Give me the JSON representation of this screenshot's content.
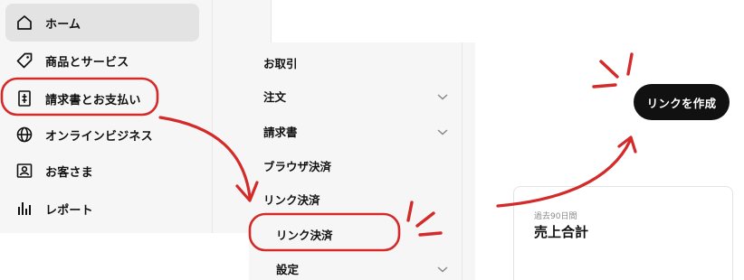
{
  "sidebar": {
    "items": [
      {
        "label": "ホーム",
        "icon": "home-icon",
        "active": true
      },
      {
        "label": "商品とサービス",
        "icon": "tag-icon"
      },
      {
        "label": "請求書とお支払い",
        "icon": "invoice-icon",
        "highlighted": true
      },
      {
        "label": "オンラインビジネス",
        "icon": "globe-icon"
      },
      {
        "label": "お客さま",
        "icon": "customer-icon"
      },
      {
        "label": "レポート",
        "icon": "bar-chart-icon"
      }
    ]
  },
  "submenu": {
    "items": [
      {
        "label": "お取引"
      },
      {
        "label": "注文",
        "icon": "chevron-down-icon"
      },
      {
        "label": "請求書",
        "icon": "chevron-down-icon"
      },
      {
        "label": "ブラウザ決済"
      },
      {
        "label": "リンク決済"
      },
      {
        "label": "リンク決済",
        "highlighted": true
      },
      {
        "label": "設定",
        "icon": "chevron-down-icon"
      }
    ]
  },
  "content": {
    "create_link_label": "リンクを作成",
    "sales_card": {
      "period": "過去90日間",
      "title": "売上合計"
    }
  },
  "annotation": {
    "color": "#d32a2a"
  }
}
